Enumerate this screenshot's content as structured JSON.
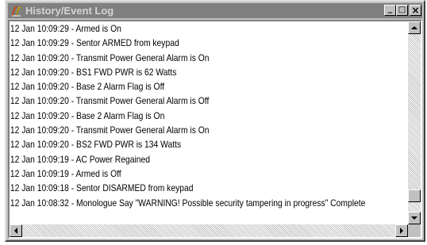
{
  "window": {
    "title": "History/Event Log",
    "icon": "pen-tool-icon",
    "controls": [
      "minimize",
      "maximize",
      "close"
    ],
    "control_glyphs": {
      "minimize": "_",
      "maximize": "□",
      "close": "×"
    }
  },
  "log": {
    "entries": [
      "12 Jan 10:09:29 - Armed is On",
      "12 Jan 10:09:29 - Sentor ARMED from keypad",
      "12 Jan 10:09:20 - Transmit Power General Alarm is On",
      "12 Jan 10:09:20 - BS1 FWD PWR is 62 Watts",
      "12 Jan 10:09:20 - Base 2 Alarm Flag is Off",
      "12 Jan 10:09:20 - Transmit Power General Alarm is Off",
      "12 Jan 10:09:20 - Base 2 Alarm Flag is On",
      "12 Jan 10:09:20 - Transmit Power General Alarm is On",
      "12 Jan 10:09:20 - BS2 FWD PWR is 134 Watts",
      "12 Jan 10:09:19 - AC Power Regained",
      "12 Jan 10:09:19 - Armed is Off",
      "12 Jan 10:09:18 - Sentor DISARMED from keypad",
      "12 Jan 10:08:32 - Monologue Say \"WARNING! Possible security tampering in progress\" Complete"
    ]
  },
  "colors": {
    "titlebar_inactive": "#808080",
    "title_text": "#d4d4d4",
    "face": "#c0c0c0",
    "list_background": "#ffffff"
  }
}
